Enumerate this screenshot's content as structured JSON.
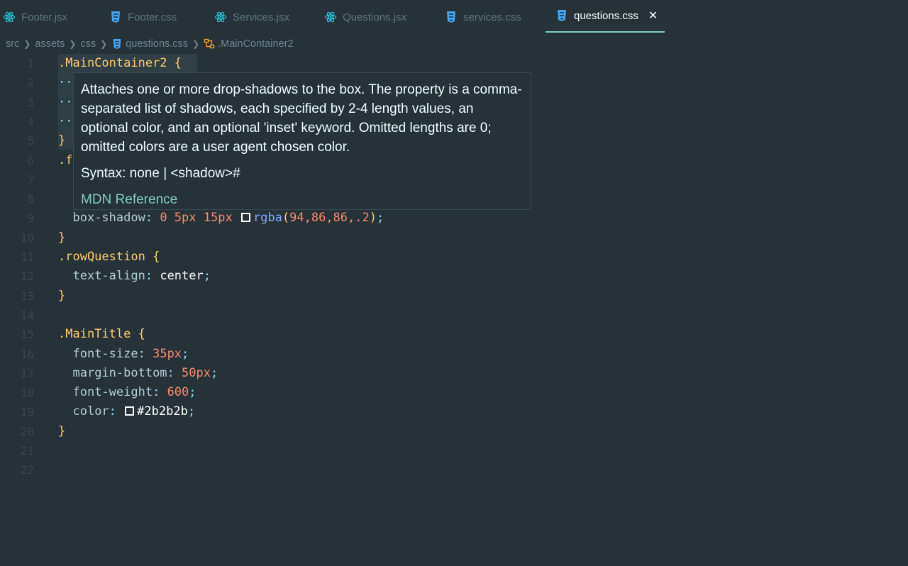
{
  "tabs": [
    {
      "label": "Footer.jsx",
      "icon": "react-icon"
    },
    {
      "label": "Footer.css",
      "icon": "css-icon"
    },
    {
      "label": "Services.jsx",
      "icon": "react-icon"
    },
    {
      "label": "Questions.jsx",
      "icon": "react-icon"
    },
    {
      "label": "services.css",
      "icon": "css-icon"
    },
    {
      "label": "questions.css",
      "icon": "css-icon",
      "active": true
    }
  ],
  "breadcrumb": [
    "src",
    "assets",
    "css",
    "questions.css",
    ".MainContainer2"
  ],
  "line_numbers": [
    "1",
    "2",
    "3",
    "4",
    "5",
    "6",
    "7",
    "8",
    "9",
    "10",
    "11",
    "12",
    "13",
    "14",
    "15",
    "16",
    "17",
    "18",
    "19",
    "20",
    "21",
    "22"
  ],
  "code": {
    "l1_selector": ".MainContainer2",
    "l1_brace": " {",
    "l2": "··",
    "l3": "··",
    "l4": "··",
    "l5": "}",
    "l6": ".f",
    "l9_prop": "box-shadow",
    "l9_vals": "0 5px 15px",
    "l9_fn": "rgba",
    "l9_args": "94,86,86,.2",
    "l10": "}",
    "l11_selector": ".rowQuestion",
    "l12_prop": "text-align",
    "l12_val": "center",
    "l13": "}",
    "l15_selector": ".MainTitle",
    "l16_prop": "font-size",
    "l16_val": "35px",
    "l17_prop": "margin-bottom",
    "l17_val": "50px",
    "l18_prop": "font-weight",
    "l18_val": "600",
    "l19_prop": "color",
    "l19_val": "#2b2b2b",
    "l20": "}"
  },
  "tooltip": {
    "description": "Attaches one or more drop-shadows to the box. The property is a comma-separated list of shadows, each specified by 2-4 length values, an optional color, and an optional 'inset' keyword. Omitted lengths are 0; omitted colors are a user agent chosen color.",
    "syntax": "Syntax: none | <shadow>#",
    "link": "MDN Reference"
  },
  "colors": {
    "background": "#263238",
    "accent": "#80cbc4",
    "selector": "#ffcb6b",
    "number": "#f78c6c"
  }
}
